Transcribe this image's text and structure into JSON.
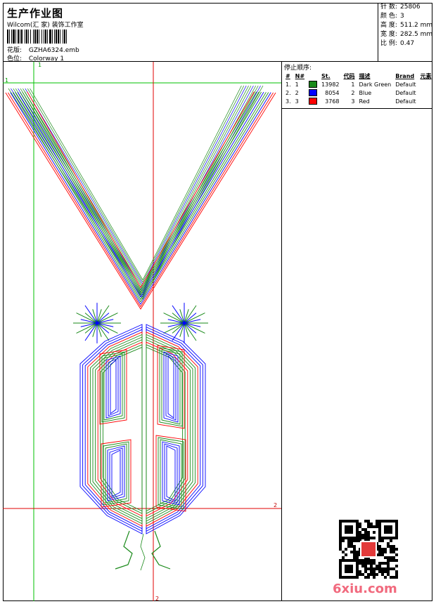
{
  "header": {
    "title": "生产作业图",
    "company": "Wilcom(汇 家) 装饰工作室",
    "design_label": "花版:",
    "design_value": "GZHA6324.emb",
    "colorway_label": "色位:",
    "colorway_value": "Colorway 1"
  },
  "stats": {
    "stitches": {
      "label": "针 数:",
      "value": "25806"
    },
    "colors": {
      "label": "颜 色:",
      "value": "3"
    },
    "height": {
      "label": "高 度:",
      "value": "511.2 mm"
    },
    "width": {
      "label": "宽 度:",
      "value": "282.5 mm"
    },
    "scale": {
      "label": "比 例:",
      "value": "0.47"
    }
  },
  "stop_sequence": {
    "title": "停止顺序:",
    "columns": [
      "#",
      "N#",
      "St.",
      "代码",
      "描述",
      "Brand",
      "元素"
    ],
    "rows": [
      {
        "num": "1.",
        "n": "1",
        "color": "#1a8a1a",
        "stitches": "13982",
        "code": "1",
        "desc": "Dark Green",
        "brand": "Default"
      },
      {
        "num": "2.",
        "n": "2",
        "color": "#0000ff",
        "stitches": "8054",
        "code": "2",
        "desc": "Blue",
        "brand": "Default"
      },
      {
        "num": "3.",
        "n": "3",
        "color": "#ff0000",
        "stitches": "3768",
        "code": "3",
        "desc": "Red",
        "brand": "Default"
      }
    ]
  },
  "markers": {
    "v1": "1",
    "h1": "1",
    "h2": "2",
    "v2": "2"
  },
  "watermark": "6xiu.com",
  "thread_colors": {
    "green": "#1a8a1a",
    "blue": "#0000ff",
    "red": "#ff0000"
  }
}
